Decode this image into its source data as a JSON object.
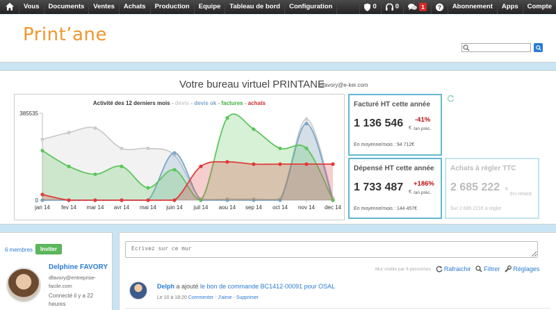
{
  "nav": {
    "items": [
      "Vous",
      "Documents",
      "Ventes",
      "Achats",
      "Production",
      "Equipe",
      "Tableau de bord",
      "Configuration"
    ],
    "shield_count": "0",
    "support_count": "0",
    "messages_count": "1",
    "right_items": [
      "Abonnement",
      "Apps",
      "Compte"
    ]
  },
  "header": {
    "logo": "Print’ane",
    "search_value": ""
  },
  "office": {
    "title": "Votre bureau virtuel PRINTANE",
    "email": "dfavory@e-ker.com"
  },
  "chart_data": {
    "type": "area",
    "title": "Activité des 12 derniers mois",
    "categories": [
      "jan 14",
      "fev 14",
      "mar 14",
      "avr 14",
      "mai 14",
      "juin 14",
      "juil 14",
      "aou 14",
      "sep 14",
      "oct 14",
      "nov 14",
      "dec 14"
    ],
    "ylim": [
      0,
      385535
    ],
    "yticks": [
      "385535",
      "0"
    ],
    "series": [
      {
        "name": "devis",
        "color": "#cccccc",
        "values": [
          270000,
          300000,
          320000,
          230000,
          230000,
          200000,
          5000,
          5000,
          5000,
          5000,
          360000,
          10000
        ]
      },
      {
        "name": "devis ok",
        "color": "#7aa6c8",
        "values": [
          0,
          0,
          0,
          0,
          0,
          210000,
          0,
          0,
          0,
          0,
          340000,
          0
        ]
      },
      {
        "name": "factures",
        "color": "#5cc65c",
        "values": [
          220000,
          150000,
          115000,
          150000,
          55000,
          135000,
          0,
          365000,
          315000,
          230000,
          230000,
          0
        ]
      },
      {
        "name": "achats",
        "color": "#e03a3a",
        "values": [
          25000,
          0,
          0,
          0,
          0,
          0,
          150000,
          170000,
          160000,
          160000,
          160000,
          160000
        ]
      }
    ]
  },
  "stats": {
    "billed": {
      "title": "Facturé HT cette année",
      "value": "1 136 546",
      "currency": "€",
      "pct": "-41%",
      "prev": "/an préc.",
      "foot": "En moyenne/mois : 94 712€"
    },
    "spent": {
      "title": "Dépensé HT cette année",
      "value": "1 733 487",
      "currency": "€",
      "pct": "+186%",
      "prev": "/an préc.",
      "foot": "En moyenne/mois : 144 457€"
    },
    "purchases": {
      "title": "Achats à régler TTC",
      "value": "2 685 222",
      "currency": "€",
      "late": "En retard",
      "foot": "Sur 2 685 221€  à régler"
    }
  },
  "members": {
    "count_label": "6 membres",
    "invite_label": "Inviter"
  },
  "user": {
    "name": "Delphine FAVORY",
    "email": "dfavory@entreprise-facile.com",
    "status": "Connecté il y a 22 heures"
  },
  "wall": {
    "placeholder": "Ecrivez sur ce mur",
    "visibility": "Mur visible par 6 personnes",
    "refresh": "Rafraichir",
    "filter": "Filtrer",
    "settings": "Réglages",
    "post": {
      "author": "Delph",
      "action": " a ajouté ",
      "object": "le bon de commande BC1412-00091 pour OSAL",
      "time": "Le 10 à 18:20",
      "comment": "Commenter",
      "like": "J'aime",
      "delete": "Supprimer"
    }
  }
}
